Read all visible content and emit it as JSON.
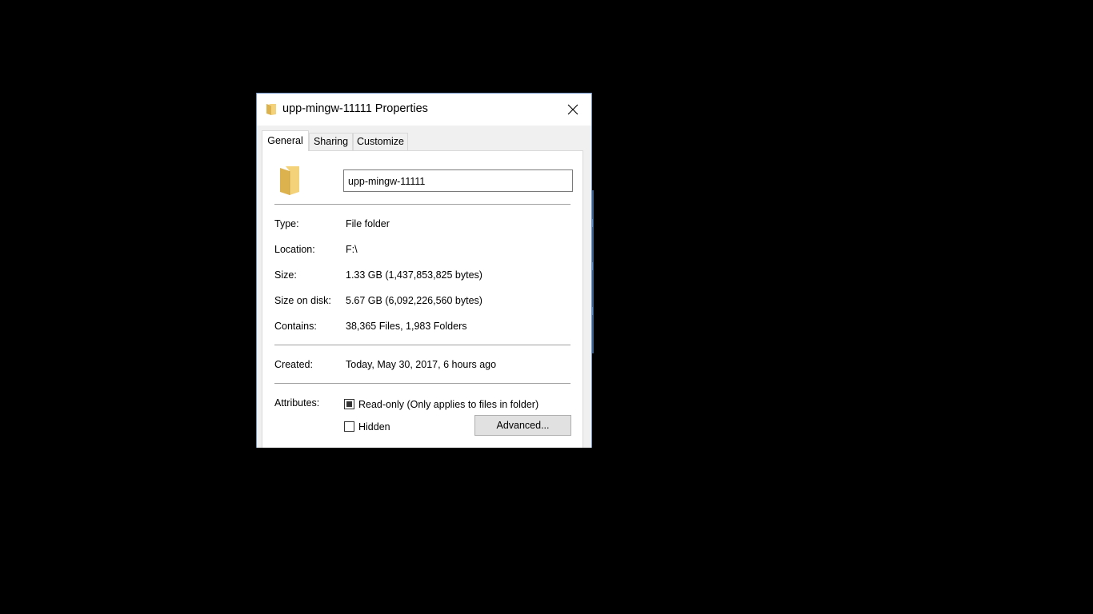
{
  "dialog": {
    "title": "upp-mingw-11111 Properties",
    "title_icon": "folder-icon",
    "close_icon": "close-icon",
    "tabs": [
      {
        "label": "General",
        "active": true
      },
      {
        "label": "Sharing",
        "active": false
      },
      {
        "label": "Customize",
        "active": false
      }
    ],
    "general": {
      "folder_icon": "folder-icon",
      "name_value": "upp-mingw-11111",
      "properties": [
        {
          "label": "Type:",
          "value": "File folder"
        },
        {
          "label": "Location:",
          "value": "F:\\"
        },
        {
          "label": "Size:",
          "value": "1.33 GB (1,437,853,825 bytes)"
        },
        {
          "label": "Size on disk:",
          "value": "5.67 GB (6,092,226,560 bytes)"
        },
        {
          "label": "Contains:",
          "value": "38,365 Files, 1,983 Folders"
        }
      ],
      "created": {
        "label": "Created:",
        "value": "Today, May 30, 2017, 6 hours ago"
      },
      "attributes": {
        "label": "Attributes:",
        "readonly": {
          "label": "Read-only (Only applies to files in folder)",
          "state": "indeterminate"
        },
        "hidden": {
          "label": "Hidden",
          "state": "unchecked"
        },
        "advanced_button": "Advanced..."
      }
    }
  },
  "colors": {
    "background": "#000000",
    "dialog_bg": "#f0f0f0",
    "panel_bg": "#ffffff",
    "folder_yellow": "#f4d27a",
    "folder_dark": "#dcb24f",
    "button_bg": "#e1e1e1"
  }
}
